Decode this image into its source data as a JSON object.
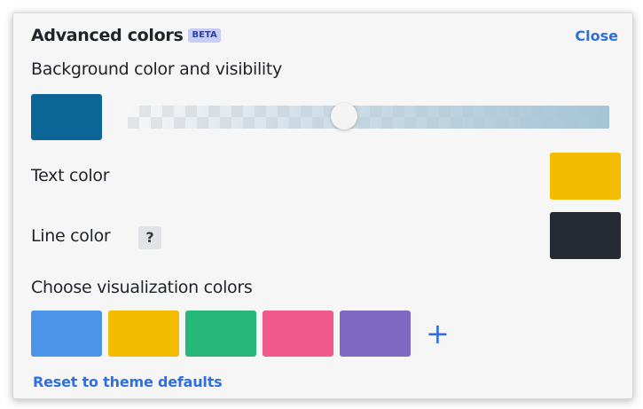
{
  "header": {
    "title": "Advanced colors",
    "badge": "BETA",
    "close_label": "Close"
  },
  "background": {
    "label": "Background color and visibility",
    "color": "#0b6596",
    "visibility": 0.45
  },
  "text": {
    "label": "Text color",
    "color": "#f4bc00"
  },
  "line": {
    "label": "Line color",
    "help_icon": "?",
    "color": "#252a33"
  },
  "visualization": {
    "label": "Choose visualization colors",
    "colors": [
      "#4c94ea",
      "#f4bc00",
      "#26b77a",
      "#f15a8c",
      "#7e68c2"
    ],
    "add_icon": "+"
  },
  "reset_label": "Reset to theme defaults"
}
